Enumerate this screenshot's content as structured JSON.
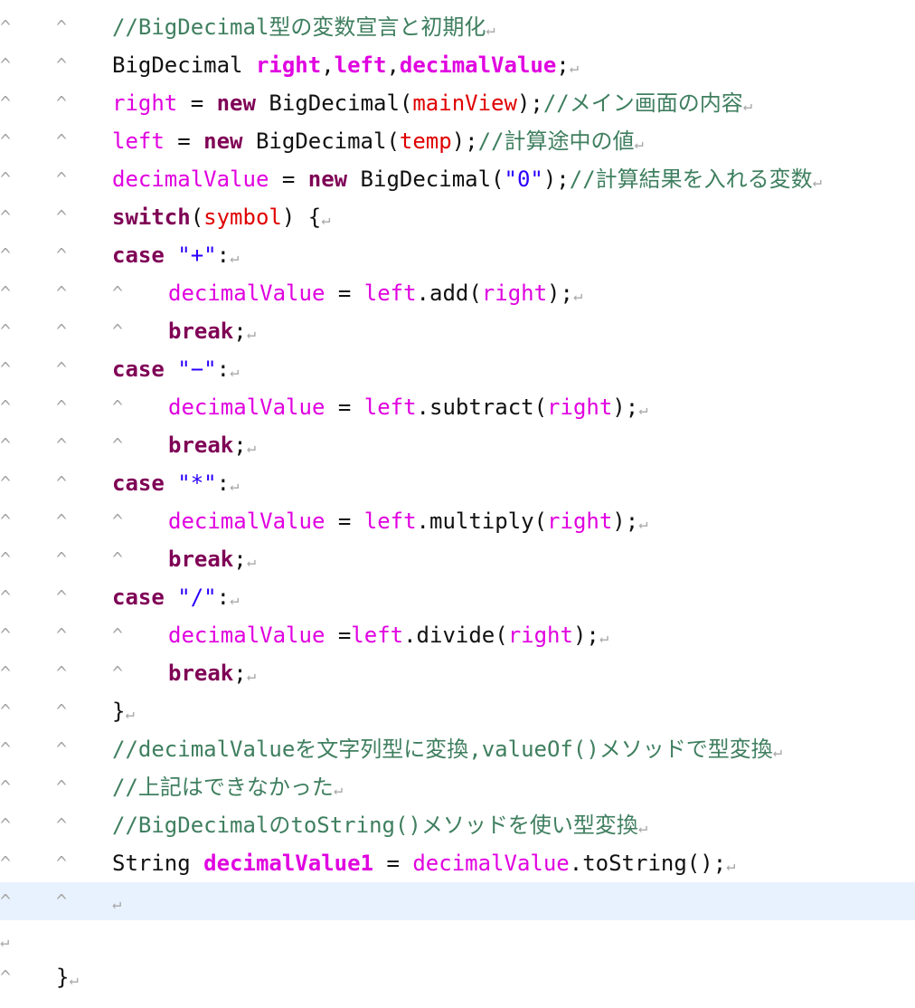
{
  "editor": {
    "tab_marker": "^",
    "eol_marker": "↵",
    "current_line_index": 23,
    "lines": [
      {
        "indent": 2,
        "tokens": [
          {
            "k": "comment",
            "t": "//BigDecimal型の変数宣言と初期化"
          }
        ]
      },
      {
        "indent": 2,
        "tokens": [
          {
            "k": "plain",
            "t": "BigDecimal "
          },
          {
            "k": "fieldb",
            "t": "right"
          },
          {
            "k": "plain",
            "t": ","
          },
          {
            "k": "fieldb",
            "t": "left"
          },
          {
            "k": "plain",
            "t": ","
          },
          {
            "k": "fieldb",
            "t": "decimalValue"
          },
          {
            "k": "plain",
            "t": ";"
          }
        ]
      },
      {
        "indent": 2,
        "tokens": [
          {
            "k": "field",
            "t": "right"
          },
          {
            "k": "plain",
            "t": " = "
          },
          {
            "k": "kw",
            "t": "new"
          },
          {
            "k": "plain",
            "t": " BigDecimal("
          },
          {
            "k": "param",
            "t": "mainView"
          },
          {
            "k": "plain",
            "t": ");"
          },
          {
            "k": "comment",
            "t": "//メイン画面の内容"
          }
        ]
      },
      {
        "indent": 2,
        "tokens": [
          {
            "k": "field",
            "t": "left"
          },
          {
            "k": "plain",
            "t": " = "
          },
          {
            "k": "kw",
            "t": "new"
          },
          {
            "k": "plain",
            "t": " BigDecimal("
          },
          {
            "k": "param",
            "t": "temp"
          },
          {
            "k": "plain",
            "t": ");"
          },
          {
            "k": "comment",
            "t": "//計算途中の値"
          }
        ]
      },
      {
        "indent": 2,
        "tokens": [
          {
            "k": "field",
            "t": "decimalValue"
          },
          {
            "k": "plain",
            "t": " = "
          },
          {
            "k": "kw",
            "t": "new"
          },
          {
            "k": "plain",
            "t": " BigDecimal("
          },
          {
            "k": "str",
            "t": "\"0\""
          },
          {
            "k": "plain",
            "t": ");"
          },
          {
            "k": "comment",
            "t": "//計算結果を入れる変数"
          }
        ]
      },
      {
        "indent": 2,
        "tokens": [
          {
            "k": "kw",
            "t": "switch"
          },
          {
            "k": "plain",
            "t": "("
          },
          {
            "k": "param",
            "t": "symbol"
          },
          {
            "k": "plain",
            "t": ") {"
          }
        ]
      },
      {
        "indent": 2,
        "tokens": [
          {
            "k": "kw",
            "t": "case"
          },
          {
            "k": "plain",
            "t": " "
          },
          {
            "k": "str",
            "t": "\"+\""
          },
          {
            "k": "plain",
            "t": ":"
          }
        ]
      },
      {
        "indent": 3,
        "tokens": [
          {
            "k": "field",
            "t": "decimalValue"
          },
          {
            "k": "plain",
            "t": " = "
          },
          {
            "k": "field",
            "t": "left"
          },
          {
            "k": "plain",
            "t": ".add("
          },
          {
            "k": "field",
            "t": "right"
          },
          {
            "k": "plain",
            "t": ");"
          }
        ]
      },
      {
        "indent": 3,
        "tokens": [
          {
            "k": "kw",
            "t": "break"
          },
          {
            "k": "plain",
            "t": ";"
          }
        ]
      },
      {
        "indent": 2,
        "tokens": [
          {
            "k": "kw",
            "t": "case"
          },
          {
            "k": "plain",
            "t": " "
          },
          {
            "k": "str",
            "t": "\"−\""
          },
          {
            "k": "plain",
            "t": ":"
          }
        ]
      },
      {
        "indent": 3,
        "tokens": [
          {
            "k": "field",
            "t": "decimalValue"
          },
          {
            "k": "plain",
            "t": " = "
          },
          {
            "k": "field",
            "t": "left"
          },
          {
            "k": "plain",
            "t": ".subtract("
          },
          {
            "k": "field",
            "t": "right"
          },
          {
            "k": "plain",
            "t": ");"
          }
        ]
      },
      {
        "indent": 3,
        "tokens": [
          {
            "k": "kw",
            "t": "break"
          },
          {
            "k": "plain",
            "t": ";"
          }
        ]
      },
      {
        "indent": 2,
        "tokens": [
          {
            "k": "kw",
            "t": "case"
          },
          {
            "k": "plain",
            "t": " "
          },
          {
            "k": "str",
            "t": "\"*\""
          },
          {
            "k": "plain",
            "t": ":"
          }
        ]
      },
      {
        "indent": 3,
        "tokens": [
          {
            "k": "field",
            "t": "decimalValue"
          },
          {
            "k": "plain",
            "t": " = "
          },
          {
            "k": "field",
            "t": "left"
          },
          {
            "k": "plain",
            "t": ".multiply("
          },
          {
            "k": "field",
            "t": "right"
          },
          {
            "k": "plain",
            "t": ");"
          }
        ]
      },
      {
        "indent": 3,
        "tokens": [
          {
            "k": "kw",
            "t": "break"
          },
          {
            "k": "plain",
            "t": ";"
          }
        ]
      },
      {
        "indent": 2,
        "tokens": [
          {
            "k": "kw",
            "t": "case"
          },
          {
            "k": "plain",
            "t": " "
          },
          {
            "k": "str",
            "t": "\"/\""
          },
          {
            "k": "plain",
            "t": ":"
          }
        ]
      },
      {
        "indent": 3,
        "tokens": [
          {
            "k": "field",
            "t": "decimalValue"
          },
          {
            "k": "plain",
            "t": " ="
          },
          {
            "k": "field",
            "t": "left"
          },
          {
            "k": "plain",
            "t": ".divide("
          },
          {
            "k": "field",
            "t": "right"
          },
          {
            "k": "plain",
            "t": ");"
          }
        ]
      },
      {
        "indent": 3,
        "tokens": [
          {
            "k": "kw",
            "t": "break"
          },
          {
            "k": "plain",
            "t": ";"
          }
        ]
      },
      {
        "indent": 2,
        "tokens": [
          {
            "k": "plain",
            "t": "}"
          }
        ]
      },
      {
        "indent": 2,
        "tokens": [
          {
            "k": "comment",
            "t": "//decimalValueを文字列型に変換,valueOf()メソッドで型変換"
          }
        ]
      },
      {
        "indent": 2,
        "tokens": [
          {
            "k": "comment",
            "t": "//上記はできなかった"
          }
        ]
      },
      {
        "indent": 2,
        "tokens": [
          {
            "k": "comment",
            "t": "//BigDecimalのtoString()メソッドを使い型変換"
          }
        ]
      },
      {
        "indent": 2,
        "tokens": [
          {
            "k": "plain",
            "t": "String "
          },
          {
            "k": "fieldb",
            "t": "decimalValue1"
          },
          {
            "k": "plain",
            "t": " = "
          },
          {
            "k": "field",
            "t": "decimalValue"
          },
          {
            "k": "plain",
            "t": ".toString();"
          }
        ]
      },
      {
        "indent": 2,
        "tokens": []
      },
      {
        "indent": 0,
        "tokens": []
      },
      {
        "indent": 1,
        "tokens": [
          {
            "k": "plain",
            "t": "}"
          }
        ]
      }
    ]
  }
}
